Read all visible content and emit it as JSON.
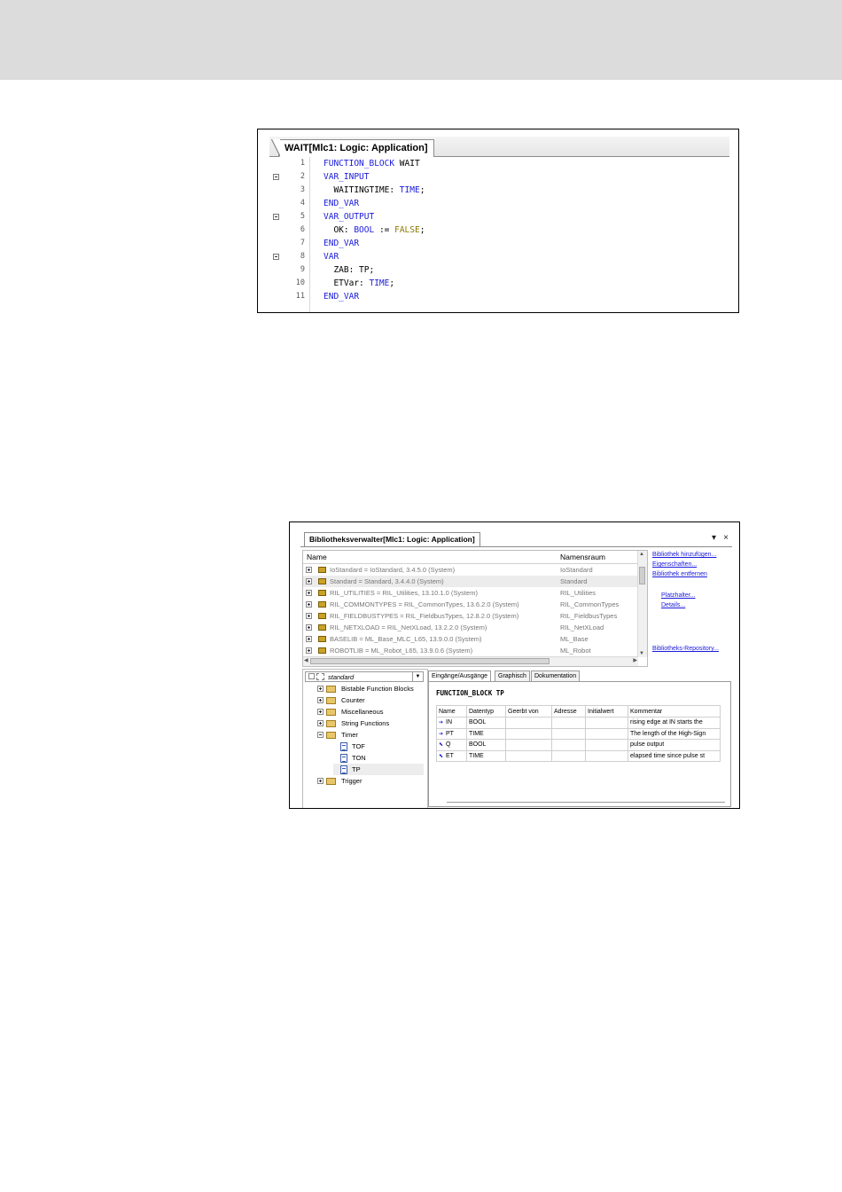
{
  "editor": {
    "tab_title": "WAIT[Mlc1: Logic: Application]",
    "lines": [
      {
        "num": "1",
        "fold": false,
        "parts": [
          {
            "t": "FUNCTION_BLOCK ",
            "c": "kw"
          },
          {
            "t": "WAIT",
            "c": "plain"
          }
        ]
      },
      {
        "num": "2",
        "fold": true,
        "parts": [
          {
            "t": "VAR_INPUT",
            "c": "kw"
          }
        ]
      },
      {
        "num": "3",
        "fold": false,
        "parts": [
          {
            "t": "  WAITINGTIME: ",
            "c": "plain"
          },
          {
            "t": "TIME",
            "c": "kw"
          },
          {
            "t": ";",
            "c": "plain"
          }
        ]
      },
      {
        "num": "4",
        "fold": false,
        "parts": [
          {
            "t": "END_VAR",
            "c": "kw"
          }
        ]
      },
      {
        "num": "5",
        "fold": true,
        "parts": [
          {
            "t": "VAR_OUTPUT",
            "c": "kw"
          }
        ]
      },
      {
        "num": "6",
        "fold": false,
        "parts": [
          {
            "t": "  OK: ",
            "c": "plain"
          },
          {
            "t": "BOOL",
            "c": "kw"
          },
          {
            "t": " := ",
            "c": "plain"
          },
          {
            "t": "FALSE",
            "c": "lit"
          },
          {
            "t": ";",
            "c": "plain"
          }
        ]
      },
      {
        "num": "7",
        "fold": false,
        "parts": [
          {
            "t": "END_VAR",
            "c": "kw"
          }
        ]
      },
      {
        "num": "8",
        "fold": true,
        "parts": [
          {
            "t": "VAR",
            "c": "kw"
          }
        ]
      },
      {
        "num": "9",
        "fold": false,
        "parts": [
          {
            "t": "  ZAB: TP;",
            "c": "plain"
          }
        ]
      },
      {
        "num": "10",
        "fold": false,
        "parts": [
          {
            "t": "  ETVar: ",
            "c": "plain"
          },
          {
            "t": "TIME",
            "c": "kw"
          },
          {
            "t": ";",
            "c": "plain"
          }
        ]
      },
      {
        "num": "11",
        "fold": false,
        "parts": [
          {
            "t": "END_VAR",
            "c": "kw"
          }
        ]
      }
    ]
  },
  "libmanager": {
    "tab_title": "Bibliotheksverwalter[Mlc1: Logic: Application]",
    "controls": {
      "menu": "▾",
      "close": "×"
    },
    "grid_headers": {
      "name": "Name",
      "namespace": "Namensraum"
    },
    "libraries": [
      {
        "name": "IoStandard = IoStandard, 3.4.5.0 (System)",
        "ns": "IoStandard"
      },
      {
        "name": "Standard = Standard, 3.4.4.0 (System)",
        "ns": "Standard"
      },
      {
        "name": "RIL_UTILITIES = RIL_Utilities, 13.10.1.0 (System)",
        "ns": "RIL_Utilities"
      },
      {
        "name": "RIL_COMMONTYPES = RIL_CommonTypes, 13.6.2.0 (System)",
        "ns": "RIL_CommonTypes"
      },
      {
        "name": "RIL_FIELDBUSTYPES = RIL_FieldbusTypes, 12.8.2.0 (System)",
        "ns": "RIL_FieldbusTypes"
      },
      {
        "name": "RIL_NETXLOAD = RIL_NetXLoad, 13.2.2.0 (System)",
        "ns": "RIL_NetXLoad"
      },
      {
        "name": "BASELIB = ML_Base_MLC_L65, 13.9.0.0 (System)",
        "ns": "ML_Base"
      },
      {
        "name": "ROBOTLIB = ML_Robot_L65, 13.9.0.6 (System)",
        "ns": "ML_Robot"
      }
    ],
    "links": [
      "Bibliothek hinzufügen...",
      "Eigenschaften...",
      "Bibliothek entfernen",
      "Platzhalter...",
      "Details...",
      "Bibliotheks-Repository..."
    ],
    "tree": {
      "root": "standard",
      "nodes": [
        {
          "label": "Bistable Function Blocks",
          "kind": "folder",
          "level": 1
        },
        {
          "label": "Counter",
          "kind": "folder",
          "level": 1
        },
        {
          "label": "Miscellaneous",
          "kind": "folder",
          "level": 1
        },
        {
          "label": "String Functions",
          "kind": "folder",
          "level": 1
        },
        {
          "label": "Timer",
          "kind": "folder",
          "level": 1,
          "open": true
        },
        {
          "label": "TOF",
          "kind": "pou",
          "level": 2
        },
        {
          "label": "TON",
          "kind": "pou",
          "level": 2
        },
        {
          "label": "TP",
          "kind": "pou",
          "level": 2,
          "selected": true
        },
        {
          "label": "Trigger",
          "kind": "folder",
          "level": 1
        }
      ]
    },
    "detail_tabs": [
      "Eingänge/Ausgänge",
      "Graphisch",
      "Dokumentation"
    ],
    "fb_title": "FUNCTION_BLOCK TP",
    "io_headers": [
      "Name",
      "Datentyp",
      "Geerbt von",
      "Adresse",
      "Initialwert",
      "Kommentar"
    ],
    "io_rows": [
      {
        "icon": "input",
        "name": "IN",
        "type": "BOOL",
        "comment": "rising edge at IN starts the"
      },
      {
        "icon": "input",
        "name": "PT",
        "type": "TIME",
        "comment": "The length of the High-Sign"
      },
      {
        "icon": "output",
        "name": "Q",
        "type": "BOOL",
        "comment": "pulse output"
      },
      {
        "icon": "output",
        "name": "ET",
        "type": "TIME",
        "comment": "elapsed time since pulse st"
      }
    ]
  }
}
